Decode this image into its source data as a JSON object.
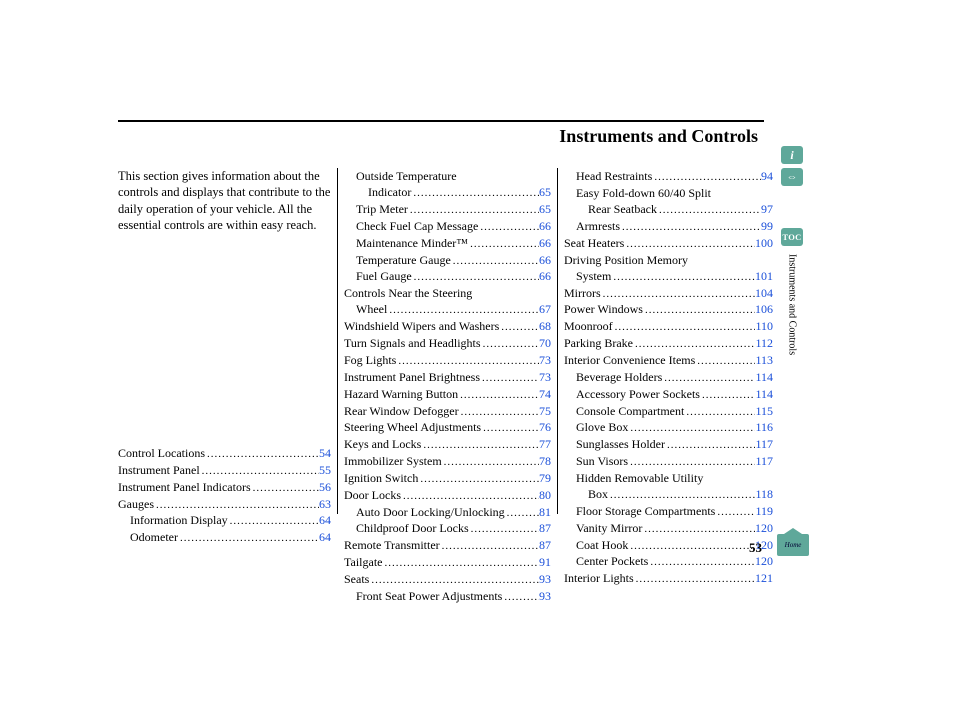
{
  "page": {
    "title": "Instruments and Controls",
    "intro": "This section gives information about the controls and displays that contribute to the daily operation of your vehicle. All the essential controls are within easy reach.",
    "page_number": "53",
    "side_section_label": "Instruments and Controls"
  },
  "tabs": {
    "info": "i",
    "car": "⇔",
    "toc": "TOC",
    "home": "Home"
  },
  "col1": [
    {
      "label": "Control Locations",
      "page": "54",
      "indent": 0
    },
    {
      "label": "Instrument Panel",
      "page": "55",
      "indent": 0
    },
    {
      "label": "Instrument Panel Indicators",
      "page": "56",
      "indent": 0
    },
    {
      "label": "Gauges",
      "page": "63",
      "indent": 0
    },
    {
      "label": "Information Display",
      "page": "64",
      "indent": 1
    },
    {
      "label": "Odometer",
      "page": "64",
      "indent": 1
    }
  ],
  "col2": [
    {
      "label": "Outside Temperature",
      "indent": 1,
      "nowrap": true
    },
    {
      "label": "Indicator",
      "page": "65",
      "indent": 2
    },
    {
      "label": "Trip Meter",
      "page": "65",
      "indent": 1
    },
    {
      "label": "Check Fuel Cap Message",
      "page": "66",
      "indent": 1
    },
    {
      "label": "Maintenance Minder™",
      "page": "66",
      "indent": 1
    },
    {
      "label": "Temperature Gauge",
      "page": "66",
      "indent": 1
    },
    {
      "label": "Fuel Gauge",
      "page": "66",
      "indent": 1
    },
    {
      "label": "Controls Near the Steering",
      "indent": 0,
      "nowrap": true
    },
    {
      "label": "Wheel",
      "page": "67",
      "indent": 1
    },
    {
      "label": "Windshield Wipers and Washers",
      "page": "68",
      "indent": 0
    },
    {
      "label": "Turn Signals and Headlights",
      "page": "70",
      "indent": 0
    },
    {
      "label": "Fog Lights",
      "page": "73",
      "indent": 0
    },
    {
      "label": "Instrument Panel Brightness",
      "page": "73",
      "indent": 0
    },
    {
      "label": "Hazard Warning Button",
      "page": "74",
      "indent": 0
    },
    {
      "label": "Rear Window Defogger",
      "page": "75",
      "indent": 0
    },
    {
      "label": "Steering Wheel Adjustments",
      "page": "76",
      "indent": 0
    },
    {
      "label": "Keys and Locks",
      "page": "77",
      "indent": 0
    },
    {
      "label": "Immobilizer System",
      "page": "78",
      "indent": 0
    },
    {
      "label": "Ignition Switch",
      "page": "79",
      "indent": 0
    },
    {
      "label": "Door Locks",
      "page": "80",
      "indent": 0
    },
    {
      "label": "Auto Door Locking/Unlocking",
      "page": "81",
      "indent": 1
    },
    {
      "label": "Childproof Door Locks",
      "page": "87",
      "indent": 1
    },
    {
      "label": "Remote Transmitter",
      "page": "87",
      "indent": 0
    },
    {
      "label": "Tailgate",
      "page": "91",
      "indent": 0
    },
    {
      "label": "Seats",
      "page": "93",
      "indent": 0
    },
    {
      "label": "Front Seat Power Adjustments",
      "page": "93",
      "indent": 1
    }
  ],
  "col3": [
    {
      "label": "Head Restraints",
      "page": "94",
      "indent": 1
    },
    {
      "label": "Easy Fold-down 60/40 Split",
      "indent": 1,
      "nowrap": true
    },
    {
      "label": "Rear Seatback",
      "page": "97",
      "indent": 2
    },
    {
      "label": "Armrests",
      "page": "99",
      "indent": 1
    },
    {
      "label": "Seat Heaters",
      "page": "100",
      "indent": 0
    },
    {
      "label": "Driving Position Memory",
      "indent": 0,
      "nowrap": true
    },
    {
      "label": "System",
      "page": "101",
      "indent": 1
    },
    {
      "label": "Mirrors",
      "page": "104",
      "indent": 0
    },
    {
      "label": "Power Windows",
      "page": "106",
      "indent": 0
    },
    {
      "label": "Moonroof",
      "page": "110",
      "indent": 0
    },
    {
      "label": "Parking Brake",
      "page": "112",
      "indent": 0
    },
    {
      "label": "Interior Convenience Items",
      "page": "113",
      "indent": 0
    },
    {
      "label": "Beverage Holders",
      "page": "114",
      "indent": 1
    },
    {
      "label": "Accessory Power Sockets",
      "page": "114",
      "indent": 1
    },
    {
      "label": "Console Compartment",
      "page": "115",
      "indent": 1
    },
    {
      "label": "Glove Box",
      "page": "116",
      "indent": 1
    },
    {
      "label": "Sunglasses Holder",
      "page": "117",
      "indent": 1
    },
    {
      "label": "Sun Visors",
      "page": "117",
      "indent": 1
    },
    {
      "label": "Hidden Removable Utility",
      "indent": 1,
      "nowrap": true
    },
    {
      "label": "Box",
      "page": "118",
      "indent": 2
    },
    {
      "label": "Floor Storage Compartments",
      "page": "119",
      "indent": 1
    },
    {
      "label": "Vanity Mirror",
      "page": "120",
      "indent": 1
    },
    {
      "label": "Coat Hook",
      "page": "120",
      "indent": 1
    },
    {
      "label": "Center Pockets",
      "page": "120",
      "indent": 1
    },
    {
      "label": "Interior Lights",
      "page": "121",
      "indent": 0
    }
  ]
}
